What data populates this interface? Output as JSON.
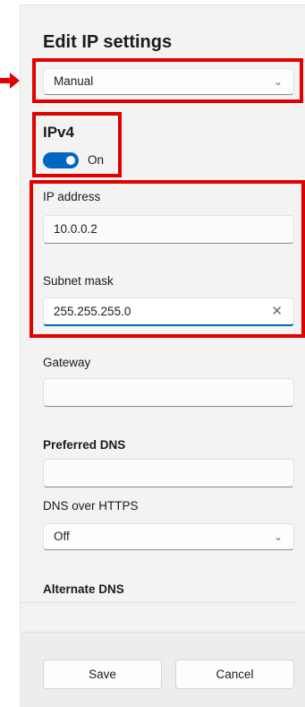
{
  "dialog": {
    "title": "Edit IP settings"
  },
  "mode_select": {
    "value": "Manual"
  },
  "ipv4": {
    "heading": "IPv4",
    "toggle_state": "On"
  },
  "ip_address": {
    "label": "IP address",
    "value": "10.0.0.2"
  },
  "subnet_mask": {
    "label": "Subnet mask",
    "value": "255.255.255.0"
  },
  "gateway": {
    "label": "Gateway",
    "value": ""
  },
  "preferred_dns": {
    "label": "Preferred DNS",
    "value": ""
  },
  "dns_over_https": {
    "label": "DNS over HTTPS",
    "value": "Off"
  },
  "alternate_dns": {
    "label": "Alternate DNS",
    "value": ""
  },
  "footer": {
    "save_label": "Save",
    "cancel_label": "Cancel"
  },
  "icons": {
    "chevron": "chevron-down-icon",
    "clear": "clear-icon",
    "arrow": "arrow-right-icon"
  },
  "colors": {
    "accent": "#0067c0",
    "highlight": "#e00000"
  }
}
